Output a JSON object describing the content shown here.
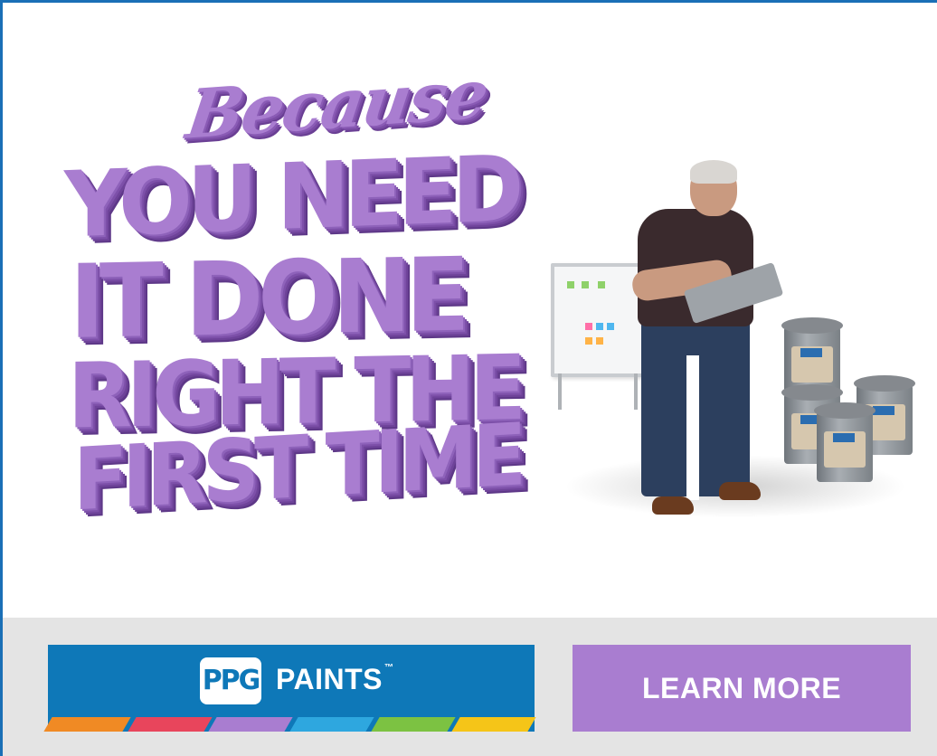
{
  "headline": {
    "because": "Because",
    "line1": "YOU NEED",
    "line2": "IT DONE",
    "line3": "RIGHT THE",
    "line4": "FIRST TIME"
  },
  "brand": {
    "logo_text": "PPG",
    "name": "PAINTS",
    "trademark": "™",
    "stripe_colors": [
      "#f08a24",
      "#e8455c",
      "#a97dd0",
      "#2ea7df",
      "#7cc242",
      "#f5c518"
    ]
  },
  "cta": {
    "label": "LEARN MORE"
  },
  "colors": {
    "accent_purple": "#a97dd0",
    "brand_blue": "#0e78b8",
    "frame_blue": "#1a6fb6",
    "footer_gray": "#e4e4e4"
  }
}
